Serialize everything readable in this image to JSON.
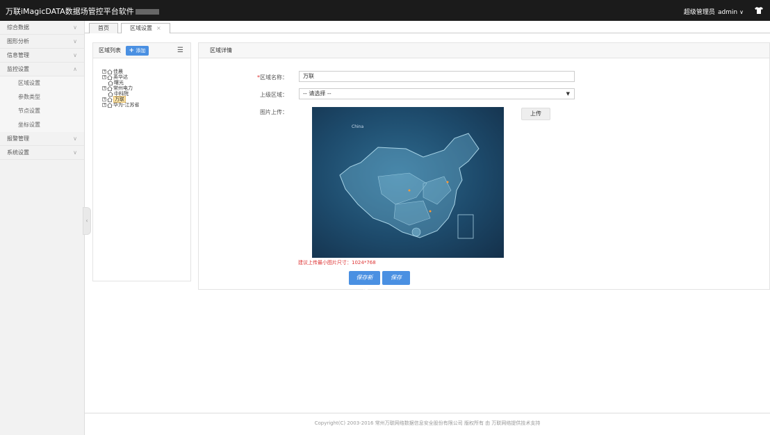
{
  "header": {
    "title": "万联iMagicDATA数据场管控平台软件",
    "role": "超级管理员",
    "username": "admin"
  },
  "sidebar": {
    "items": [
      {
        "label": "综合数据",
        "expanded": false
      },
      {
        "label": "图形分析",
        "expanded": false
      },
      {
        "label": "信息管理",
        "expanded": false
      },
      {
        "label": "监控设置",
        "expanded": true,
        "children": [
          "区域设置",
          "参数类型",
          "节点设置",
          "坐标设置"
        ]
      },
      {
        "label": "报警管理",
        "expanded": false
      },
      {
        "label": "系统设置",
        "expanded": false
      }
    ]
  },
  "tabs": [
    {
      "label": "首页"
    },
    {
      "label": "区域设置",
      "closable": true
    }
  ],
  "region_list": {
    "title": "区域列表",
    "add_label": "添加",
    "tree": [
      {
        "label": "佳晨",
        "expandable": true,
        "level": 0
      },
      {
        "label": "英华达",
        "expandable": true,
        "level": 0
      },
      {
        "label": "曙光",
        "expandable": false,
        "level": 1
      },
      {
        "label": "常州电力",
        "expandable": true,
        "level": 0
      },
      {
        "label": "中科院",
        "expandable": false,
        "level": 1
      },
      {
        "label": "万联",
        "expandable": true,
        "level": 0,
        "selected": true
      },
      {
        "label": "华为-江苏省",
        "expandable": true,
        "level": 0
      }
    ]
  },
  "detail": {
    "title": "区域详情",
    "name_label": "区域名称：",
    "name_value": "万联",
    "parent_label": "上级区域：",
    "parent_value": "-- 请选择 --",
    "image_label": "图片上传：",
    "upload_label": "上传",
    "map_caption": "China",
    "hint": "建议上传最小图片尺寸：1024*768",
    "save_new_label": "保存新增",
    "save_label": "保存"
  },
  "footer": {
    "text": "Copyright(C) 2003-2016 常州万联网络数据信息安全股份有限公司 版权所有 由 万联网络提供技术支持"
  },
  "colors": {
    "topbar": "#1b1b1b",
    "primary": "#4a90e2",
    "required": "#dd3333",
    "map_bg": "#1d4a6b"
  }
}
